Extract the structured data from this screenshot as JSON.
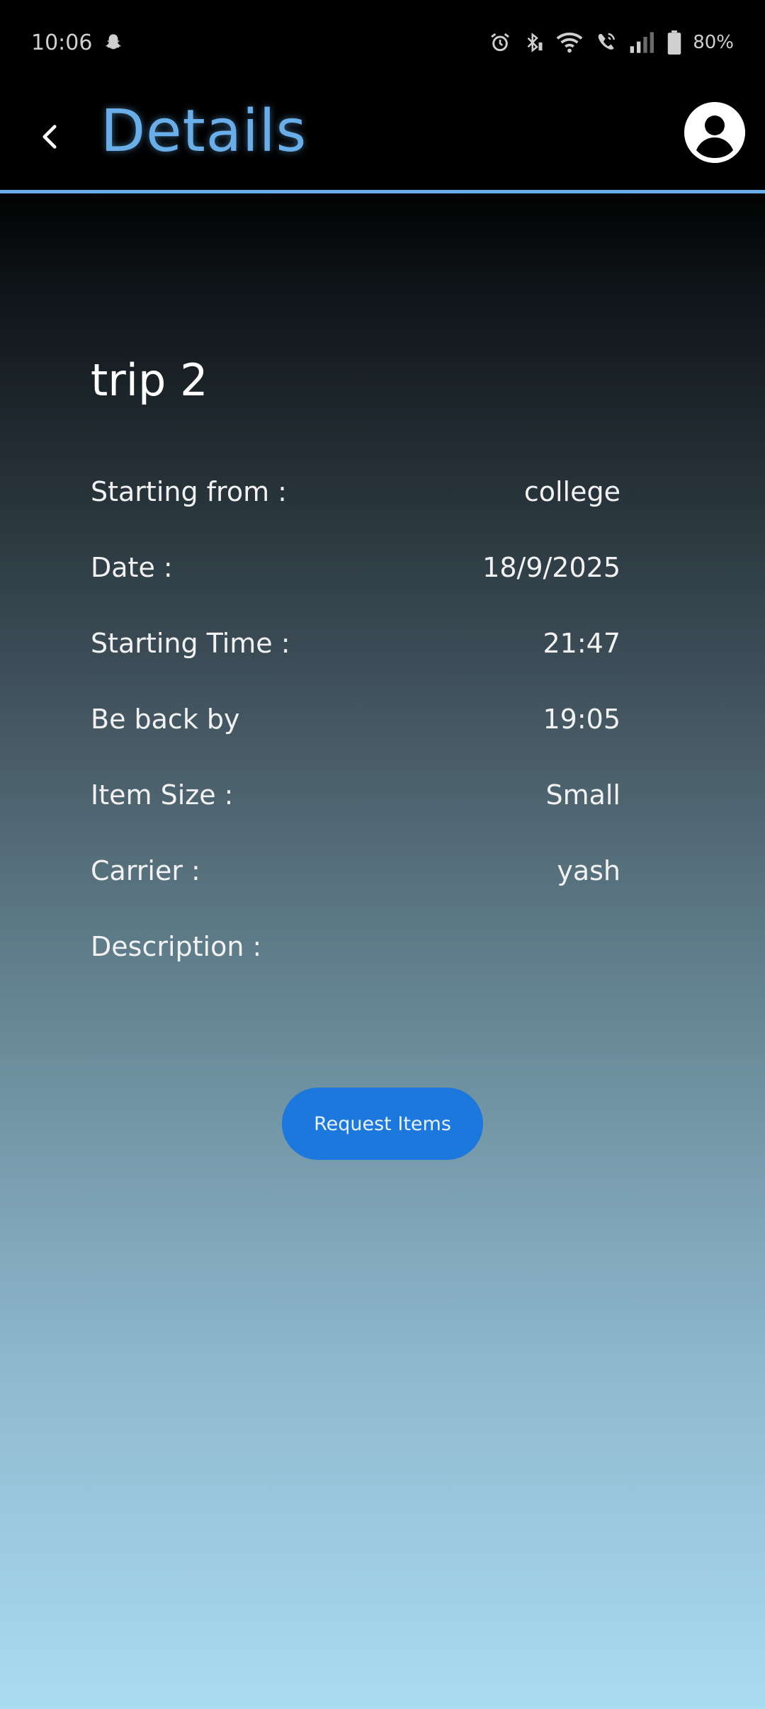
{
  "status_bar": {
    "time": "10:06",
    "battery": "80%",
    "icons": [
      "snapchat-ghost-icon",
      "alarm-icon",
      "bluetooth-icon",
      "wifi-icon",
      "wifi-call-icon",
      "signal-icon",
      "battery-icon"
    ]
  },
  "header": {
    "title": "Details",
    "back_icon": "chevron-left-icon",
    "avatar_icon": "account-circle-icon",
    "accent_color": "#6aaee9"
  },
  "trip": {
    "name": "trip 2",
    "details": [
      {
        "label": "Starting from :",
        "value": "college"
      },
      {
        "label": "Date :",
        "value": "18/9/2025"
      },
      {
        "label": "Starting Time :",
        "value": "21:47"
      },
      {
        "label": "Be back by",
        "value": "19:05"
      },
      {
        "label": "Item Size :",
        "value": "Small"
      },
      {
        "label": "Carrier :",
        "value": "yash"
      },
      {
        "label": "Description :",
        "value": ""
      }
    ]
  },
  "actions": {
    "request_label": "Request Items",
    "button_color": "#1c78dc"
  }
}
